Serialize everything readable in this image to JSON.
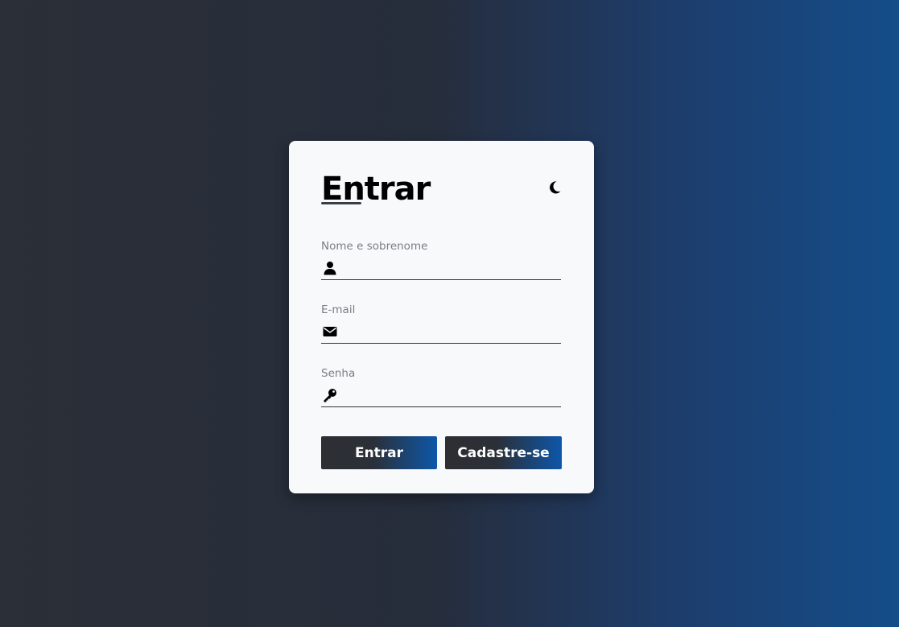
{
  "form": {
    "title": "Entrar",
    "theme_toggle_icon": "moon-icon",
    "fields": [
      {
        "label": "Nome e sobrenome",
        "icon": "user-icon",
        "value": "",
        "placeholder": ""
      },
      {
        "label": "E-mail",
        "icon": "envelope-icon",
        "value": "",
        "placeholder": ""
      },
      {
        "label": "Senha",
        "icon": "key-icon",
        "value": "",
        "placeholder": ""
      }
    ],
    "buttons": {
      "login_label": "Entrar",
      "signup_label": "Cadastre-se"
    }
  },
  "colors": {
    "card_background": "#f8f9fb",
    "button_gradient_start": "#2d2f33",
    "button_gradient_end": "#0d57a9",
    "page_gradient_start": "#2b2f37",
    "page_gradient_end": "#144d89"
  }
}
